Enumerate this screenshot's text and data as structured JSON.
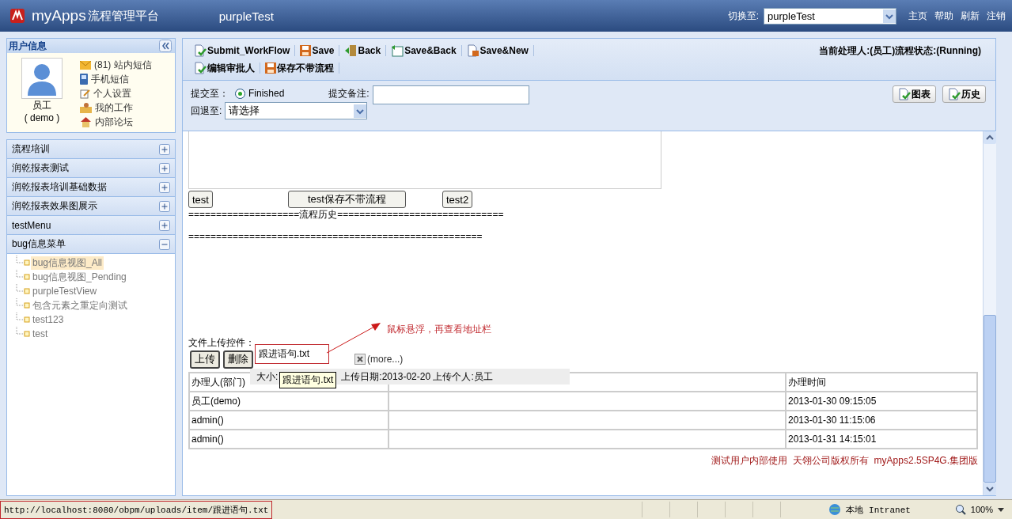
{
  "header": {
    "logo": "myApps",
    "title": "流程管理平台",
    "app": "purpleTest",
    "switch_label": "切换至:",
    "switch_value": "purpleTest",
    "links": [
      "主页",
      "帮助",
      "刷新",
      "注销"
    ]
  },
  "user_panel": {
    "title": "用户信息",
    "name": "员工",
    "account": "( demo )",
    "links": [
      {
        "kind": "mail",
        "label": "(81) 站内短信"
      },
      {
        "kind": "phone",
        "label": "手机短信"
      },
      {
        "kind": "edit",
        "label": "个人设置"
      },
      {
        "kind": "work",
        "label": "我的工作"
      },
      {
        "kind": "home",
        "label": "内部论坛"
      }
    ]
  },
  "menu": [
    {
      "label": "流程培训",
      "expanded": false
    },
    {
      "label": "润乾报表测试",
      "expanded": false
    },
    {
      "label": "润乾报表培训基础数据",
      "expanded": false
    },
    {
      "label": "润乾报表效果图展示",
      "expanded": false
    },
    {
      "label": "testMenu",
      "expanded": false
    },
    {
      "label": "bug信息菜单",
      "expanded": true,
      "children": [
        {
          "label": "bug信息视图_All",
          "selected": true
        },
        {
          "label": "bug信息视图_Pending",
          "selected": false
        },
        {
          "label": "purpleTestView",
          "selected": false
        },
        {
          "label": "包含元素之重定向测试",
          "selected": false
        },
        {
          "label": "test123",
          "selected": false
        },
        {
          "label": "test",
          "selected": false
        }
      ]
    }
  ],
  "toolbar": {
    "rows": [
      [
        {
          "kind": "submit",
          "label": "Submit_WorkFlow"
        },
        {
          "kind": "save",
          "label": "Save"
        },
        {
          "kind": "back",
          "label": "Back"
        },
        {
          "kind": "saveback",
          "label": "Save&Back"
        },
        {
          "kind": "savenew",
          "label": "Save&New"
        }
      ],
      [
        {
          "kind": "submit",
          "label": "编辑审批人"
        },
        {
          "kind": "save",
          "label": "保存不带流程"
        }
      ]
    ],
    "status": "当前处理人:(员工)流程状态:(Running)"
  },
  "form": {
    "submit_to_label": "提交至：",
    "option": {
      "label": "Finished",
      "selected": true
    },
    "note_label": "提交备注:",
    "back_label": "回退至:",
    "back_value": "请选择",
    "buttons": [
      "图表",
      "历史"
    ]
  },
  "content": {
    "buttons": [
      "test",
      "test保存不带流程",
      "test2"
    ],
    "history_line": "====================流程历史==============================",
    "end_line": "====================================================="
  },
  "upload": {
    "label": "文件上传控件：",
    "buttons": [
      "上传",
      "删除"
    ],
    "file": "跟进语句.txt",
    "more": "(more...)",
    "popup_size": "大小:",
    "popup_info": "上传日期:2013-02-20 上传个人:员工",
    "tooltip": "跟进语句.txt"
  },
  "annotation": "鼠标悬浮，再查看地址栏",
  "table": {
    "columns": [
      "办理人(部门)",
      "办理时间"
    ],
    "rows": [
      {
        "handler": "员工(demo)",
        "time": "2013-01-30 09:15:05"
      },
      {
        "handler": "admin()",
        "time": "2013-01-30 11:15:06"
      },
      {
        "handler": "admin()",
        "time": "2013-01-31 14:15:01"
      }
    ]
  },
  "footer": "测试用户内部使用  天翎公司版权所有  myApps2.5SP4G.集团版",
  "status_bar": {
    "url": "http://localhost:8080/obpm/uploads/item/跟进语句.txt",
    "zone": "本地 Intranet",
    "zoom": "100%"
  }
}
